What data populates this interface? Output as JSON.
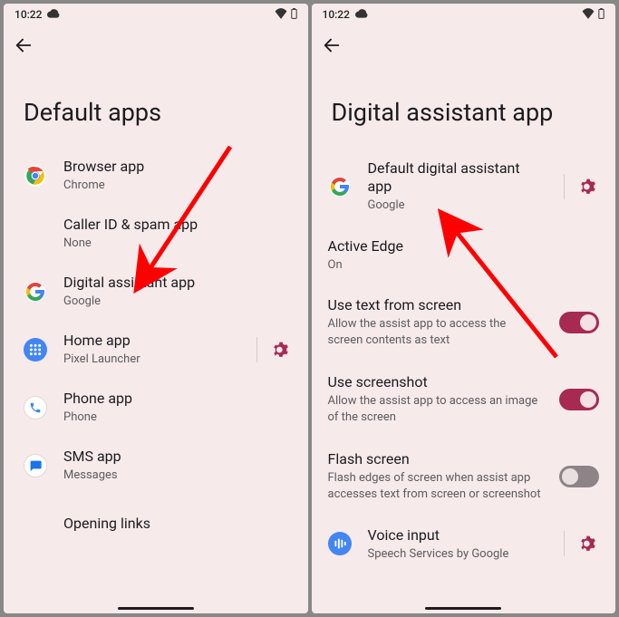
{
  "status": {
    "time": "10:22"
  },
  "left": {
    "title": "Default apps",
    "rows": [
      {
        "key": "browser",
        "icon": "chrome-icon",
        "primary": "Browser app",
        "secondary": "Chrome"
      },
      {
        "key": "callerid",
        "icon": null,
        "primary": "Caller ID & spam app",
        "secondary": "None"
      },
      {
        "key": "assistant",
        "icon": "google-g-icon",
        "primary": "Digital assistant app",
        "secondary": "Google"
      },
      {
        "key": "home",
        "icon": "apps-grid-icon",
        "primary": "Home app",
        "secondary": "Pixel Launcher",
        "gear": true
      },
      {
        "key": "phone",
        "icon": "phone-icon",
        "primary": "Phone app",
        "secondary": "Phone"
      },
      {
        "key": "sms",
        "icon": "messages-icon",
        "primary": "SMS app",
        "secondary": "Messages"
      },
      {
        "key": "opening",
        "icon": null,
        "primary": "Opening links",
        "secondary": ""
      }
    ]
  },
  "right": {
    "title": "Digital assistant app",
    "rows": [
      {
        "key": "default-assist",
        "icon": "google-g-icon",
        "primary": "Default digital assistant app",
        "secondary": "Google",
        "gear": true
      },
      {
        "key": "active-edge",
        "icon": null,
        "primary": "Active Edge",
        "secondary": "On"
      },
      {
        "key": "use-text",
        "icon": null,
        "primary": "Use text from screen",
        "secondary": "Allow the assist app to access the screen contents as text",
        "switch": "on"
      },
      {
        "key": "use-shot",
        "icon": null,
        "primary": "Use screenshot",
        "secondary": "Allow the assist app to access an image of the screen",
        "switch": "on"
      },
      {
        "key": "flash",
        "icon": null,
        "primary": "Flash screen",
        "secondary": "Flash edges of screen when assist app accesses text from screen or screenshot",
        "switch": "off"
      },
      {
        "key": "voice-input",
        "icon": "speech-icon",
        "primary": "Voice input",
        "secondary": "Speech Services by Google",
        "gear": true
      }
    ]
  }
}
